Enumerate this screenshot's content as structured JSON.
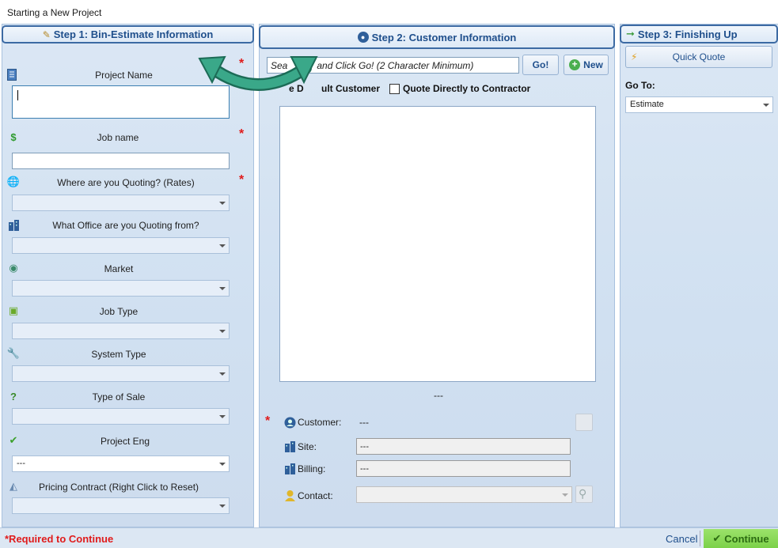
{
  "window": {
    "title": "Starting a New Project"
  },
  "step1": {
    "header": "Step 1: Bin-Estimate Information",
    "project_name_label": "Project Name",
    "job_name_label": "Job name",
    "quoting_where_label": "Where are you Quoting? (Rates)",
    "office_label": "What Office are you Quoting from?",
    "market_label": "Market",
    "job_type_label": "Job Type",
    "system_type_label": "System Type",
    "type_of_sale_label": "Type of Sale",
    "project_eng_label": "Project Eng",
    "project_eng_value": "---",
    "pricing_contract_label": "Pricing Contract (Right Click to Reset)",
    "required_mark": "*"
  },
  "step2": {
    "header": "Step 2: Customer Information",
    "search_text": "Search and Click Go! (2 Character Minimum)",
    "search_visible_prefix": "Sea",
    "search_visible_suffix": "and Click Go! (2 Character Minimum)",
    "go_label": "Go!",
    "new_label": "New",
    "use_default_label": "ult Customer",
    "use_default_visible_prefix": "e D",
    "quote_contractor_label": "Quote Directly to Contractor",
    "list_caption": "---",
    "customer_label": "Customer:",
    "customer_value": "---",
    "site_label": "Site:",
    "site_value": "---",
    "billing_label": "Billing:",
    "billing_value": "---",
    "contact_label": "Contact:",
    "required_mark": "*"
  },
  "step3": {
    "header": "Step 3: Finishing Up",
    "quick_quote_label": "Quick Quote",
    "goto_label": "Go To:",
    "goto_value": "Estimate"
  },
  "footer": {
    "required_text": "*Required to Continue",
    "cancel_label": "Cancel",
    "continue_label": "Continue"
  },
  "colors": {
    "accent": "#1f4f8c",
    "required": "#e01b1b",
    "continue_bg": "#8bd95b",
    "swap_arrow": "#3aa889"
  }
}
